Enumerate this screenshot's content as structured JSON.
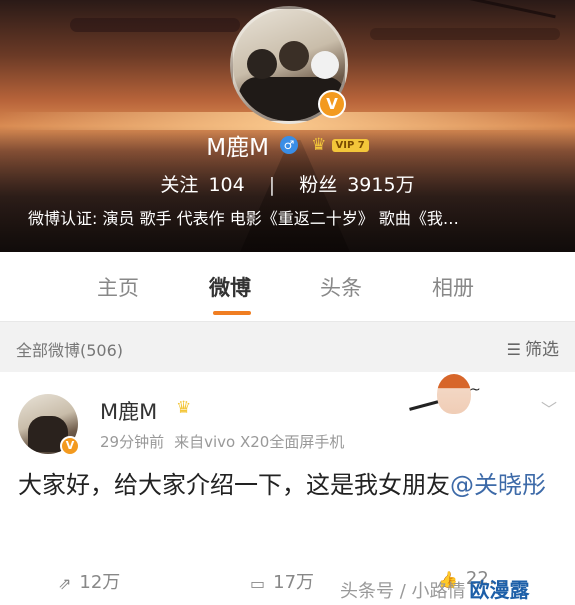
{
  "profile": {
    "name": "M鹿M",
    "gender_icon": "male-icon",
    "vip_label": "VIP 7",
    "verified_badge": "V",
    "following_label": "关注",
    "following_count": "104",
    "followers_label": "粉丝",
    "followers_count": "3915万",
    "verification_text": "微博认证: 演员 歌手 代表作 电影《重返二十岁》 歌曲《我…"
  },
  "tabs": [
    {
      "label": "主页"
    },
    {
      "label": "微博",
      "active": true
    },
    {
      "label": "头条"
    },
    {
      "label": "相册"
    }
  ],
  "filter_bar": {
    "count_label": "全部微博(506)",
    "filter_label": "筛选"
  },
  "post": {
    "author": "M鹿M",
    "time": "29分钟前",
    "source": "来自vivo X20全面屏手机",
    "text_main": "大家好，给大家介绍一下，这是我女朋友",
    "mention": "@关晓彤",
    "repost_count": "12万",
    "comment_count": "17万",
    "like_count": "22…"
  },
  "watermark": {
    "text": "头条号 / 小路情",
    "brand": "欧漫露"
  },
  "colors": {
    "accent_orange": "#f07e22",
    "vip_gold": "#f3c63a",
    "mention_blue": "#3d6aa8"
  }
}
